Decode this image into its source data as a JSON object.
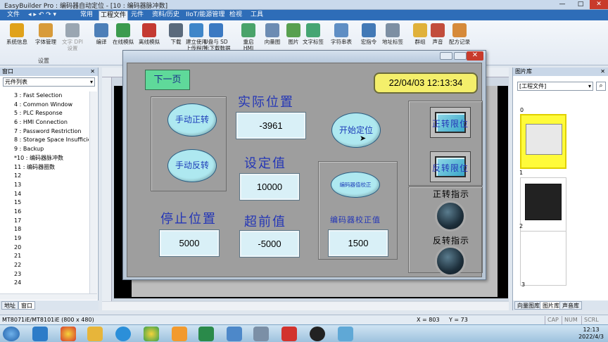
{
  "app": {
    "title": "EasyBuilder Pro : 编码器自动定位 - [10 : 编码器脉冲数]",
    "min": "—",
    "max": "□",
    "close": "✕"
  },
  "menu": [
    "文件",
    "常用",
    "工程文件",
    "元件",
    "资料/历史",
    "IIoT/能源管理",
    "检视",
    "工具"
  ],
  "ribbon": {
    "buttons": [
      {
        "label": "系统信息",
        "color": "#e0a21b"
      },
      {
        "label": "字体管理",
        "color": "#d89b3a"
      },
      {
        "label": "文字 DPI\n设置",
        "color": "#9aa6b2"
      },
      {
        "label": "编译",
        "color": "#4d7fb8"
      },
      {
        "label": "在线模拟",
        "color": "#3c9b4e"
      },
      {
        "label": "离线模拟",
        "color": "#c43a32"
      },
      {
        "label": "下载",
        "color": "#5a6a7c"
      },
      {
        "label": "建立使用\n上传程序",
        "color": "#3f86c9"
      },
      {
        "label": "U盘与 SD\n卡下载数据",
        "color": "#3b79c2"
      },
      {
        "label": "重启\nHMI",
        "color": "#4aa36a"
      },
      {
        "label": "向量图",
        "color": "#6d8cb3"
      },
      {
        "label": "图片",
        "color": "#58a04f"
      },
      {
        "label": "文字标签",
        "color": "#45a573"
      },
      {
        "label": "字符串表",
        "color": "#5f8ec4"
      },
      {
        "label": "宏指令",
        "color": "#4279b6"
      },
      {
        "label": "地址标签",
        "color": "#7d8fa3"
      },
      {
        "label": "群组",
        "color": "#e0b13a"
      },
      {
        "label": "声音",
        "color": "#c24d3c"
      },
      {
        "label": "配方记录",
        "color": "#d68a3a"
      }
    ],
    "group_label": "设置"
  },
  "left_panel": {
    "header": "窗口",
    "list_selector": "元件列表",
    "items": [
      "3 : Fast Selection",
      "4 : Common Window",
      "5 : PLC Response",
      "6 : HMI Connection",
      "7 : Password Restriction",
      "8 : Storage Space Insufficier",
      "9 : Backup",
      "*10 : 编码器脉冲数",
      "11 : 编码器圈数",
      "12",
      "13",
      "14",
      "15",
      "16",
      "17",
      "18",
      "19",
      "20",
      "21",
      "22",
      "23",
      "24"
    ],
    "tabs": [
      "地址",
      "窗口"
    ]
  },
  "hmi": {
    "next_page": "下一页",
    "datetime": "22/04/03 12:13:34",
    "manual_forward": "手动正转",
    "manual_reverse": "手动反转",
    "actual_position_label": "实际位置",
    "actual_position_value": "-3961",
    "set_value_label": "设定值",
    "set_value": "10000",
    "advance_label": "超前值",
    "advance_value": "-5000",
    "stop_position_label": "停止位置",
    "stop_position_value": "5000",
    "start_positioning": "开始定位",
    "encoder_calibrate_btn": "编码器值校正",
    "encoder_calibrate_label": "编码器校正值",
    "encoder_calibrate_value": "1500",
    "forward_limit": "正转限位",
    "reverse_limit": "反转限位",
    "forward_indicator": "正转指示",
    "reverse_indicator": "反转指示"
  },
  "right_panel": {
    "header": "图片库",
    "selector": "[工程文件]",
    "thumbs": [
      "0",
      "1",
      "2",
      "3"
    ],
    "tabs": [
      "向量图库",
      "图片库",
      "声音库"
    ]
  },
  "status": {
    "model": "MT8071iE/MT8101iE (800 x 480)",
    "x": "X = 803",
    "y": "Y = 73",
    "cap": "CAP",
    "num": "NUM",
    "scrl": "SCRL"
  },
  "taskbar": {
    "time": "12:13",
    "date": "2022/4/3"
  }
}
